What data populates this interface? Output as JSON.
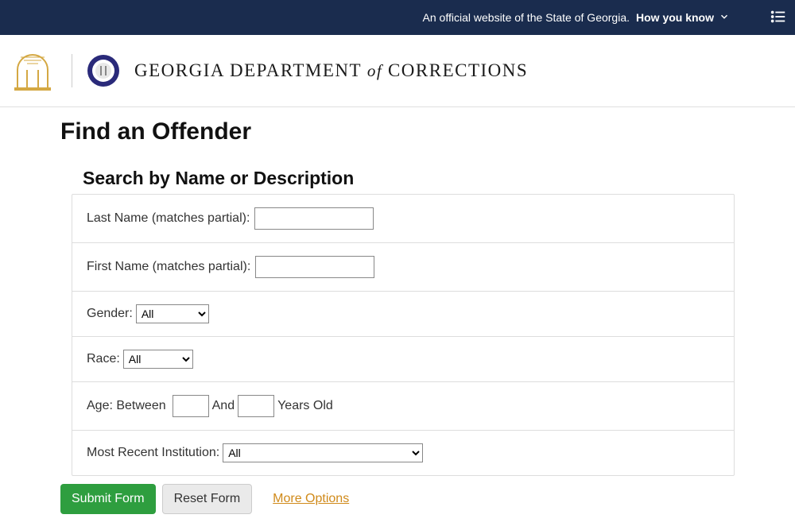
{
  "banner": {
    "official_text": "An official website of the State of Georgia.",
    "how_you_know": "How you know"
  },
  "header": {
    "dept_prefix": "GEORGIA DEPARTMENT",
    "dept_of": " of ",
    "dept_suffix": "CORRECTIONS"
  },
  "page": {
    "title": "Find an Offender",
    "section_title": "Search by Name or Description"
  },
  "form": {
    "last_name_label": "Last Name (matches partial):",
    "last_name_value": "",
    "first_name_label": "First Name (matches partial):",
    "first_name_value": "",
    "gender_label": "Gender:",
    "gender_selected": "All",
    "race_label": "Race:",
    "race_selected": "All",
    "age_prefix": "Age: Between",
    "age_and": "And",
    "age_suffix": "Years Old",
    "age_min": "",
    "age_max": "",
    "institution_label": "Most Recent Institution:",
    "institution_selected": "All"
  },
  "buttons": {
    "submit": "Submit Form",
    "reset": "Reset Form",
    "more_options": "More Options"
  }
}
